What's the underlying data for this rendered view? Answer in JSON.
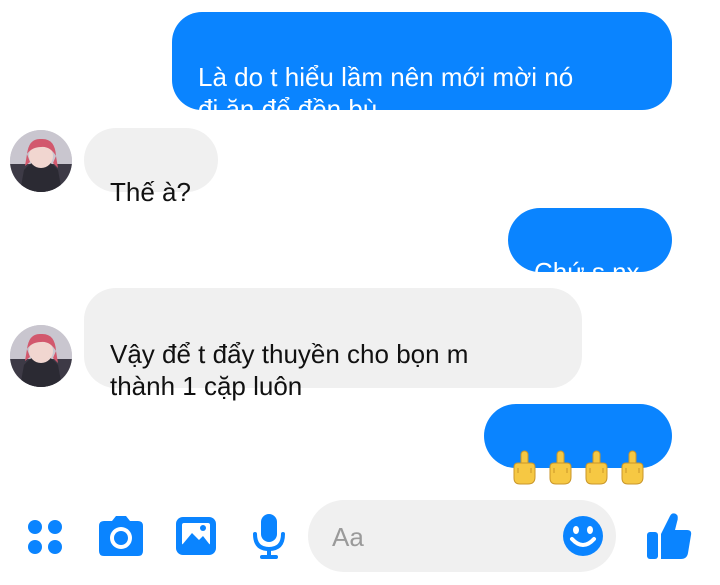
{
  "conversation": {
    "messages": [
      {
        "from": "me",
        "text": "Là do t hiểu lầm nên mới mời nó\nđi ăn để đền bù"
      },
      {
        "from": "them",
        "text": "Thế à?"
      },
      {
        "from": "me",
        "text": "Chứ s nx"
      },
      {
        "from": "them",
        "text": "Vậy để t đẩy thuyền cho bọn m\nthành 1 cặp luôn"
      },
      {
        "from": "me",
        "emoji": [
          "middle-finger",
          "middle-finger",
          "middle-finger",
          "middle-finger"
        ]
      }
    ]
  },
  "composer": {
    "placeholder": "Aa",
    "actions": [
      "menu-dots-icon",
      "camera-icon",
      "image-icon",
      "microphone-icon"
    ],
    "emoji_button": "smiley-icon",
    "send": "thumbs-up-icon"
  },
  "colors": {
    "outgoing_bubble": "#0a84ff",
    "incoming_bubble": "#f0f0f0",
    "accent": "#0a84ff"
  }
}
